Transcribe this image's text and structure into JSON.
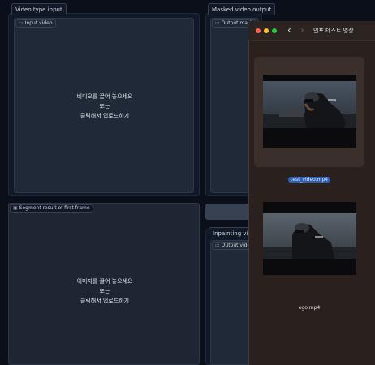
{
  "left_top": {
    "tab": "Video type input",
    "field_label": "Input video",
    "drop_line1": "비디오를 끌어 놓으세요",
    "drop_line2": "또는",
    "drop_line3": "클릭해서 업로드하기"
  },
  "right_top": {
    "tab": "Masked video output",
    "field_label": "Output mask"
  },
  "left_bottom": {
    "tab": "Segment result of first frame",
    "drop_line1": "이미지를 끌어 놓으세요",
    "drop_line2": "또는",
    "drop_line3": "클릭해서 업로드하기"
  },
  "right_bottom": {
    "tab": "Inpainting video",
    "field_label": "Output video"
  },
  "finder": {
    "title": "인포 테스트 영상",
    "nav_back": "‹",
    "nav_forward": "›",
    "files": [
      {
        "name": "test_video.mp4",
        "selected": true
      },
      {
        "name": "ego.mp4",
        "selected": false
      }
    ]
  },
  "colors": {
    "page_bg": "#0b0f19",
    "panel": "#111827",
    "finder_bg": "#2a211e",
    "selection": "#2b5fb8",
    "traffic_red": "#ff5f57",
    "traffic_yellow": "#febc2e",
    "traffic_green": "#28c840"
  }
}
